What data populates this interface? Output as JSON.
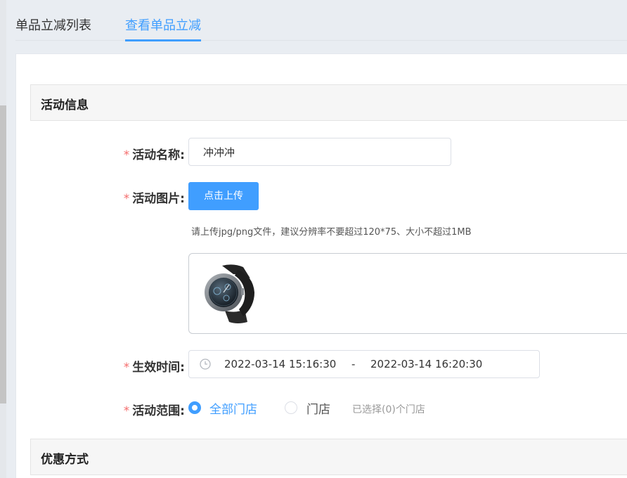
{
  "tabs": [
    {
      "label": "单品立减列表",
      "active": false
    },
    {
      "label": "查看单品立减",
      "active": true
    }
  ],
  "sections": {
    "activity_info": "活动信息",
    "discount_method": "优惠方式"
  },
  "form": {
    "required_mark": "*",
    "name_label": "活动名称:",
    "name_value": "冲冲冲",
    "image_label": "活动图片:",
    "upload_button": "点击上传",
    "upload_hint": "请上传jpg/png文件，建议分辨率不要超过120*75、大小不超过1MB",
    "time_label": "生效时间:",
    "start_time": "2022-03-14 15:16:30",
    "separator": "-",
    "end_time": "2022-03-14 16:20:30",
    "scope_label": "活动范围:",
    "scope_options": [
      {
        "label": "全部门店",
        "checked": true
      },
      {
        "label": "门店",
        "checked": false
      }
    ],
    "selected_stores": "已选择(0)个门店"
  },
  "colors": {
    "accent": "#409eff",
    "required": "#f56c6c"
  },
  "icons": {
    "clock": "clock-icon",
    "uploaded_image": "smartwatch-image"
  }
}
